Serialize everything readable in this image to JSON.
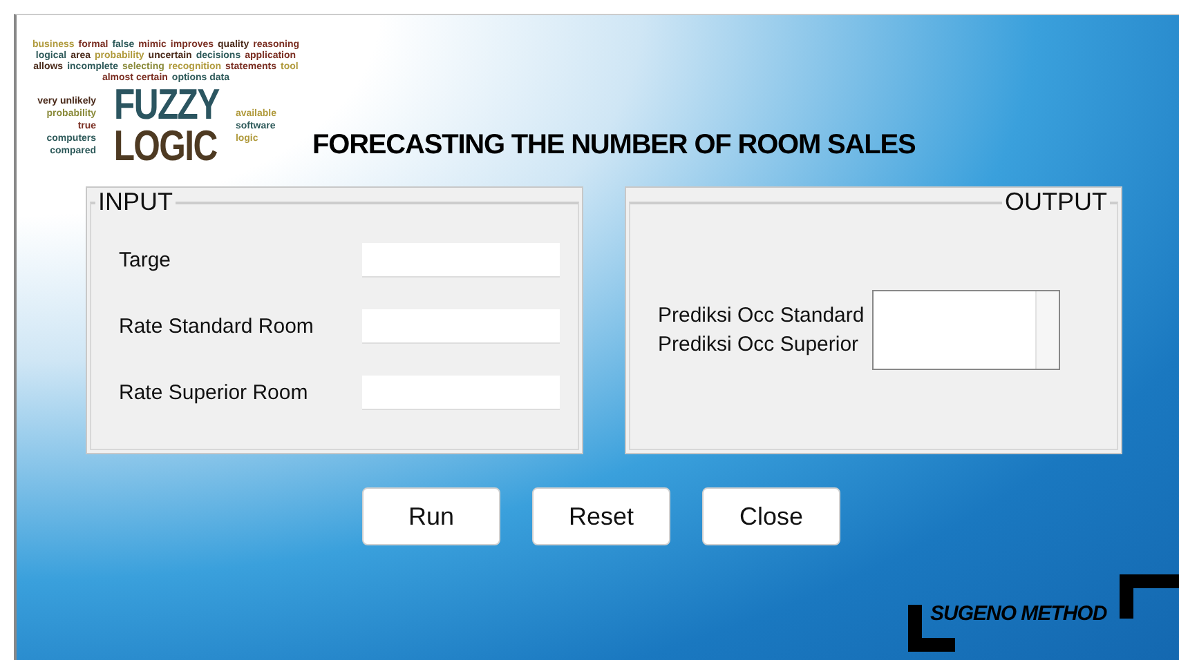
{
  "logo": {
    "top_words": [
      {
        "text": "business",
        "color": "#b09a3c"
      },
      {
        "text": "formal",
        "color": "#7a2e22"
      },
      {
        "text": "false",
        "color": "#2e5a5a"
      },
      {
        "text": "mimic",
        "color": "#7a2e22"
      },
      {
        "text": "improves",
        "color": "#7a2e22"
      },
      {
        "text": "quality",
        "color": "#4a2a1a"
      },
      {
        "text": "reasoning",
        "color": "#7a2e22"
      },
      {
        "text": "logical",
        "color": "#2e5a5a"
      },
      {
        "text": "area",
        "color": "#4a2a1a"
      },
      {
        "text": "probability",
        "color": "#b09a3c"
      },
      {
        "text": "uncertain",
        "color": "#4a2a1a"
      },
      {
        "text": "decisions",
        "color": "#2e5a5a"
      },
      {
        "text": "application",
        "color": "#7a2e22"
      },
      {
        "text": "allows",
        "color": "#4a2a1a"
      },
      {
        "text": "incomplete",
        "color": "#2e5a5a"
      },
      {
        "text": "selecting",
        "color": "#8a8a3a"
      },
      {
        "text": "recognition",
        "color": "#b09a3c"
      },
      {
        "text": "statements",
        "color": "#7a2e22"
      },
      {
        "text": "tool",
        "color": "#b09a3c"
      },
      {
        "text": "almost certain",
        "color": "#7a2e22"
      },
      {
        "text": "options data",
        "color": "#2e5a5a"
      }
    ],
    "left_words": [
      {
        "text": "very unlikely",
        "color": "#4a2a1a"
      },
      {
        "text": "probability",
        "color": "#8a8a3a"
      },
      {
        "text": "true",
        "color": "#7a2e22"
      },
      {
        "text": "computers",
        "color": "#2e5a5a"
      },
      {
        "text": "compared",
        "color": "#2e5a5a"
      }
    ],
    "big_words": [
      {
        "text": "FUZZY",
        "color": "#2b5560"
      },
      {
        "text": "LOGIC",
        "color": "#4e3a22"
      }
    ],
    "right_words": [
      {
        "text": "available",
        "color": "#b09a3c"
      },
      {
        "text": "software",
        "color": "#2e5a5a"
      },
      {
        "text": "logic",
        "color": "#b09a3c"
      }
    ]
  },
  "title": "FORECASTING THE NUMBER OF ROOM SALES",
  "input_panel": {
    "title": "INPUT",
    "fields": [
      {
        "label": "Targe"
      },
      {
        "label": "Rate Standard Room"
      },
      {
        "label": "Rate Superior Room"
      }
    ]
  },
  "output_panel": {
    "title": "OUTPUT",
    "labels": [
      "Prediksi Occ Standard",
      "Prediksi Occ Superior"
    ]
  },
  "buttons": [
    "Run",
    "Reset",
    "Close"
  ],
  "badge": "SUGENO METHOD"
}
